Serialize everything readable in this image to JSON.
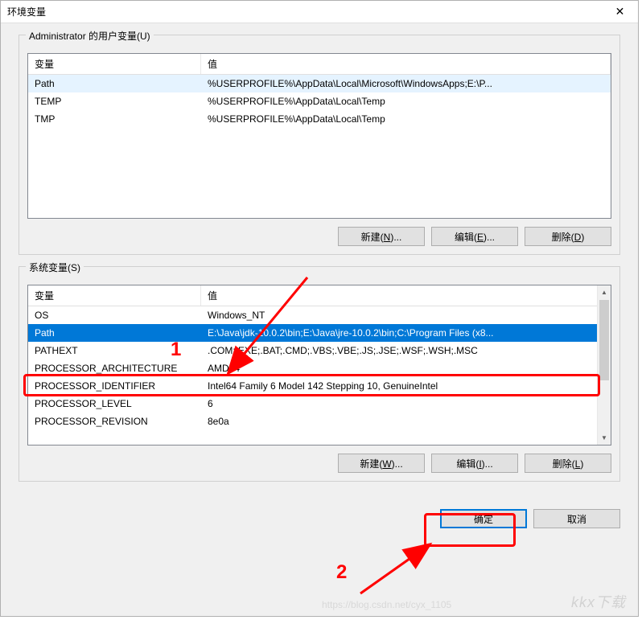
{
  "window": {
    "title": "环境变量"
  },
  "userGroup": {
    "legend": "Administrator 的用户变量(U)",
    "headers": {
      "var": "变量",
      "val": "值"
    },
    "rows": [
      {
        "var": "Path",
        "val": "%USERPROFILE%\\AppData\\Local\\Microsoft\\WindowsApps;E:\\P..."
      },
      {
        "var": "TEMP",
        "val": "%USERPROFILE%\\AppData\\Local\\Temp"
      },
      {
        "var": "TMP",
        "val": "%USERPROFILE%\\AppData\\Local\\Temp"
      }
    ],
    "buttons": {
      "new": "新建(N)...",
      "edit": "编辑(E)...",
      "delete": "删除(D)"
    }
  },
  "sysGroup": {
    "legend": "系统变量(S)",
    "headers": {
      "var": "变量",
      "val": "值"
    },
    "rows": [
      {
        "var": "OS",
        "val": "Windows_NT"
      },
      {
        "var": "Path",
        "val": "E:\\Java\\jdk-10.0.2\\bin;E:\\Java\\jre-10.0.2\\bin;C:\\Program Files (x8..."
      },
      {
        "var": "PATHEXT",
        "val": ".COM;.EXE;.BAT;.CMD;.VBS;.VBE;.JS;.JSE;.WSF;.WSH;.MSC"
      },
      {
        "var": "PROCESSOR_ARCHITECTURE",
        "val": "AMD64"
      },
      {
        "var": "PROCESSOR_IDENTIFIER",
        "val": "Intel64 Family 6 Model 142 Stepping 10, GenuineIntel"
      },
      {
        "var": "PROCESSOR_LEVEL",
        "val": "6"
      },
      {
        "var": "PROCESSOR_REVISION",
        "val": "8e0a"
      }
    ],
    "buttons": {
      "new": "新建(W)...",
      "edit": "编辑(I)...",
      "delete": "删除(L)"
    }
  },
  "dialogButtons": {
    "ok": "确定",
    "cancel": "取消"
  },
  "annotations": {
    "label1": "1",
    "label2": "2"
  },
  "watermark": "kkx下载",
  "watermark2": "https://blog.csdn.net/cyx_1105"
}
